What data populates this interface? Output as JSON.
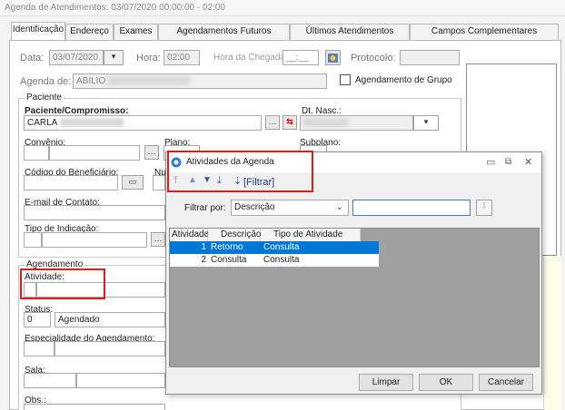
{
  "window": {
    "title": "Agenda de Atendimentos: 03/07/2020 00:00:00 - 02:00",
    "tabs": [
      "Identificação",
      "Endereço",
      "Exames",
      "Agendamentos Futuros",
      "Últimos Atendimentos",
      "Campos Complementares"
    ]
  },
  "header": {
    "data_label": "Data:",
    "data_value": "03/07/2020",
    "hora_label": "Hora:",
    "hora_value": "02:00",
    "hora_chegada_label": "Hora da Chegada:",
    "hora_chegada_value": "__:__",
    "protocolo_label": "Protocolo:",
    "agenda_label": "Agenda de:",
    "agenda_value": "ABILIO",
    "agendamento_grupo_label": "Agendamento de Grupo"
  },
  "paciente": {
    "group_title": "Paciente",
    "paciente_label": "Paciente/Compromisso:",
    "paciente_value": "CARLA",
    "dt_nasc_label": "Dt. Nasc.:",
    "convenio_label": "Convênio:",
    "plano_label": "Plano:",
    "subplano_label": "Subplano:",
    "codigo_label": "Código do Beneficiário:",
    "nu_label": "Nu",
    "email_label": "E-mail de Contato:",
    "indicacao_label": "Tipo de Indicação:"
  },
  "agendamento": {
    "group_title": "Agendamento",
    "atividade_label": "Atividade:",
    "status_label": "Status:",
    "status_code": "0",
    "status_value": "Agendado",
    "especialidade_label": "Especialidade do Agendamento:",
    "sala_label": "Sala:",
    "obs_label": "Obs.:"
  },
  "dialog": {
    "title": "Atividades da Agenda",
    "filtrar_label": "[Filtrar]",
    "filtrar_por_label": "Filtrar por:",
    "filtrar_por_value": "Descrição",
    "search_value": "",
    "columns": [
      "Atividade",
      "Descrição",
      "Tipo de Atividade"
    ],
    "rows": [
      {
        "atividade": "1",
        "descricao": "Retorno",
        "tipo": "Consulta",
        "selected": true
      },
      {
        "atividade": "2",
        "descricao": "Consulta",
        "tipo": "Consulta",
        "selected": false
      }
    ],
    "buttons": {
      "limpar": "Limpar",
      "ok": "OK",
      "cancelar": "Cancelar"
    }
  },
  "colors": {
    "highlight_red": "#e31a1a",
    "selection_blue": "#0078d7",
    "grid_background": "#a0a0a0",
    "note_panel": "#fffde8"
  }
}
